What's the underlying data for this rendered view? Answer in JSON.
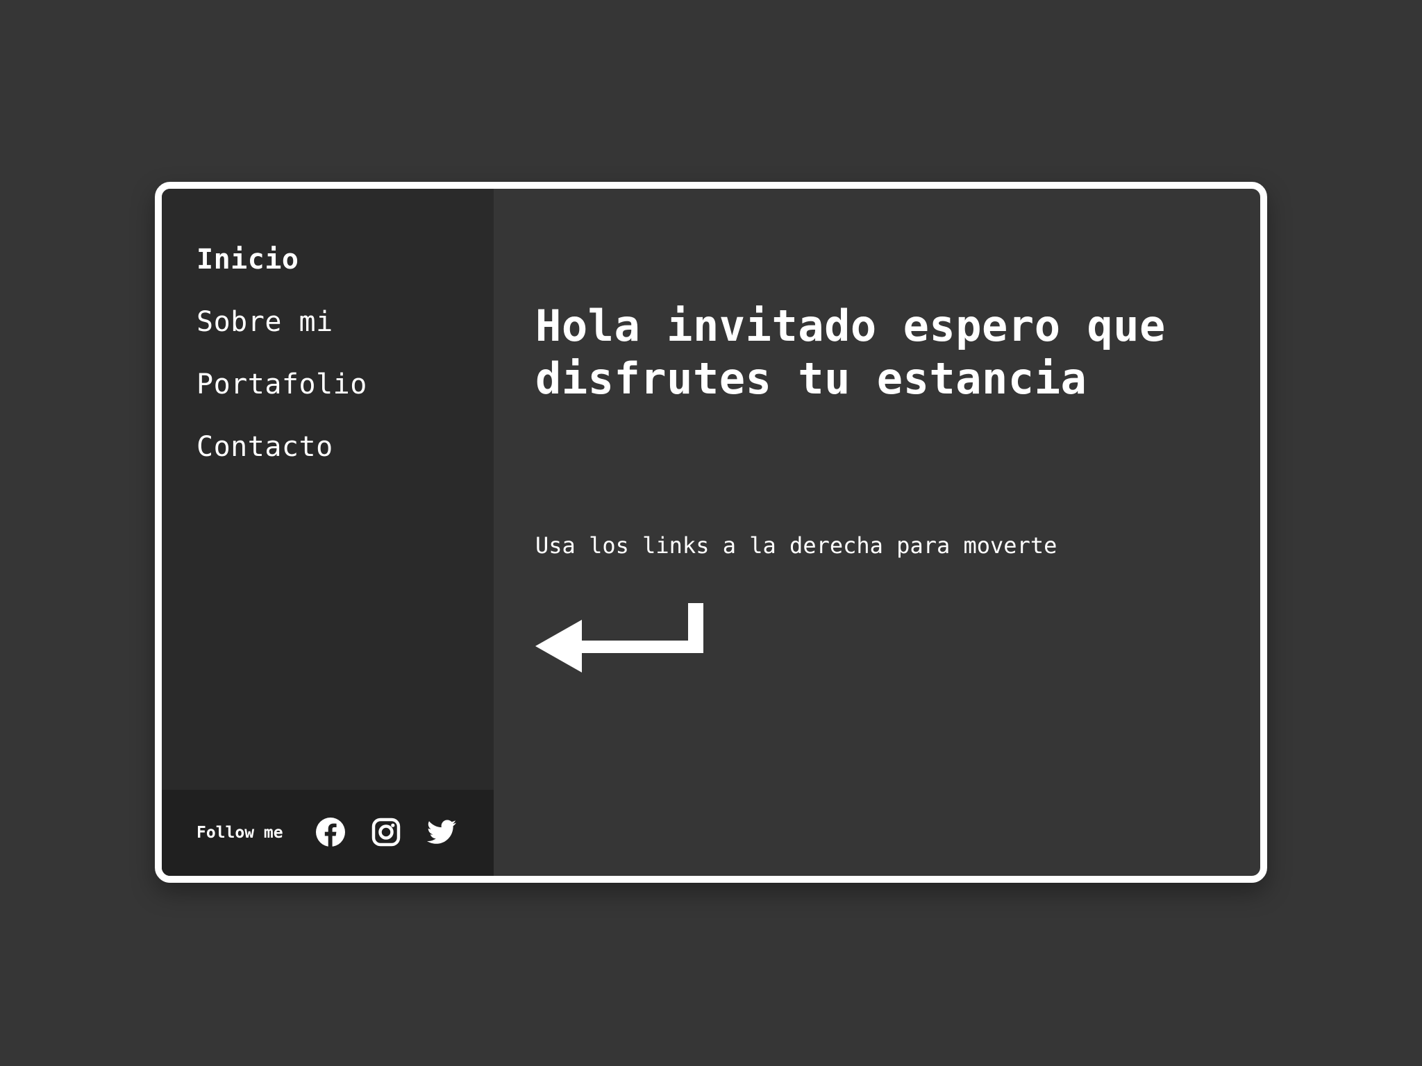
{
  "sidebar": {
    "nav_items": [
      {
        "label": "Inicio",
        "active": true
      },
      {
        "label": "Sobre mi",
        "active": false
      },
      {
        "label": "Portafolio",
        "active": false
      },
      {
        "label": "Contacto",
        "active": false
      }
    ],
    "footer": {
      "follow_label": "Follow me",
      "social_icons": [
        "facebook-icon",
        "instagram-icon",
        "twitter-icon"
      ]
    }
  },
  "main": {
    "heading": "Hola invitado espero que disfrutes tu estancia",
    "subtitle": "Usa los links a la derecha para moverte",
    "arrow_icon": "return-arrow-left-icon"
  },
  "colors": {
    "page_background": "#363636",
    "sidebar_background": "#2a2a2a",
    "footer_background": "#202020",
    "card_border": "#ffffff",
    "text": "#ffffff"
  }
}
